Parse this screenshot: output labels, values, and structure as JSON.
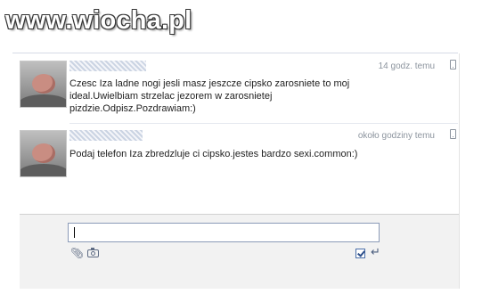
{
  "watermark": {
    "text": "www.wiocha.pl"
  },
  "messages": [
    {
      "timestamp": "14 godz. temu",
      "body": "Czesc Iza ladne nogi jesli masz jeszcze cipsko zarosniete to moj ideal.Uwielbiam strzelac jezorem w zarosnietej pizdzie.Odpisz.Pozdrawiam:)"
    },
    {
      "timestamp": "około godziny temu",
      "body": "Podaj telefon Iza zbredzluje ci cipsko.jestes bardzo sexi.common:)"
    }
  ],
  "composer": {
    "input_value": "",
    "enter_to_send_checked": true
  },
  "icons": {
    "attach": "paperclip-icon",
    "photo": "camera-icon",
    "mobile": "mobile-phone-icon",
    "enter": "enter-key-icon"
  },
  "colors": {
    "accent": "#4a6ea9",
    "timestamp": "#8c949e",
    "text": "#222222",
    "composer_bg": "#f2f2f2"
  }
}
